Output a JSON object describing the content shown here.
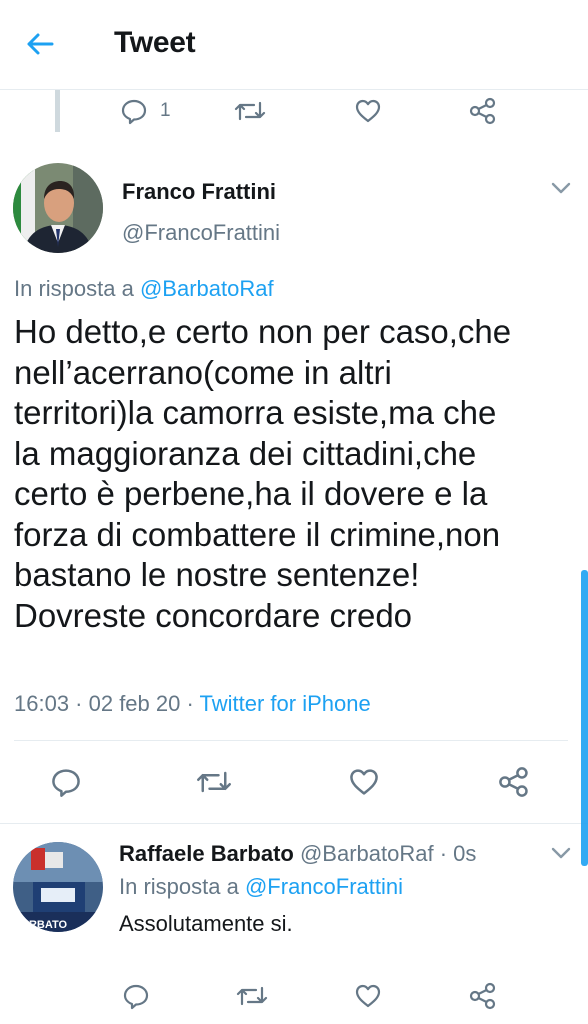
{
  "header": {
    "title": "Tweet",
    "back_icon": "arrow-left-icon"
  },
  "prev_tweet_actions": {
    "reply_count": "1"
  },
  "main_tweet": {
    "author_name": "Franco Frattini",
    "author_handle": "@FrancoFrattini",
    "reply_prefix": "In risposta a",
    "reply_mention": "@BarbatoRaf",
    "text": "Ho detto,e certo non per caso,che\nnell’acerrano(come in altri\nterritori)la camorra esiste,ma che\nla maggioranza dei cittadini,che\ncerto è perbene,ha il dovere e la\nforza di combattere il crimine,non\nbastano le nostre sentenze!\nDovreste concordare credo",
    "timestamp": "16:03 · 02 feb 20 · ",
    "source": "Twitter for iPhone"
  },
  "reply_tweet": {
    "author_name": "Raffaele Barbato",
    "author_handle": "@BarbatoRaf · 0s",
    "reply_prefix": "In risposta a",
    "reply_mention": "@FrancoFrattini",
    "text": "Assolutamente si.",
    "avatar_label": "ARBATO"
  },
  "colors": {
    "accent": "#1da1f2",
    "muted": "#657786",
    "text": "#14171a",
    "border": "#e6ecf0"
  }
}
